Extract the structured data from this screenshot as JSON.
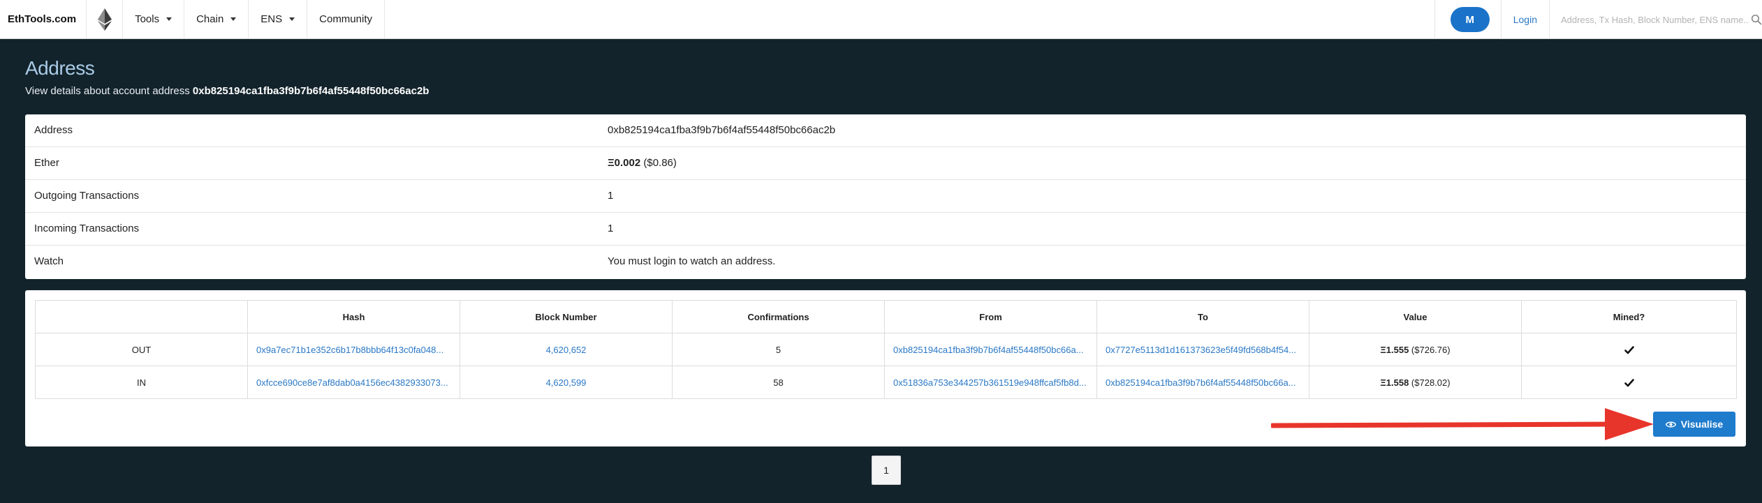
{
  "navbar": {
    "brand": "EthTools.com",
    "logo_icon": "ethereum-diamond-icon",
    "menu": [
      {
        "label": "Tools",
        "dropdown": true
      },
      {
        "label": "Chain",
        "dropdown": true
      },
      {
        "label": "ENS",
        "dropdown": true
      },
      {
        "label": "Community",
        "dropdown": false
      }
    ],
    "avatar_label": "M",
    "login_label": "Login",
    "search_placeholder": "Address, Tx Hash, Block Number, ENS name...",
    "search_icon": "search-icon"
  },
  "header": {
    "title": "Address",
    "subtitle_prefix": "View details about account address ",
    "subtitle_address": "0xb825194ca1fba3f9b7b6f4af55448f50bc66ac2b"
  },
  "details": [
    {
      "key": "Address",
      "value": "0xb825194ca1fba3f9b7b6f4af55448f50bc66ac2b"
    },
    {
      "key": "Ether",
      "value_bold": "Ξ0.002",
      "value_extra": " ($0.86)"
    },
    {
      "key": "Outgoing Transactions",
      "value": "1"
    },
    {
      "key": "Incoming Transactions",
      "value": "1"
    },
    {
      "key": "Watch",
      "value": "You must login to watch an address."
    }
  ],
  "transactions": {
    "columns": [
      "",
      "Hash",
      "Block Number",
      "Confirmations",
      "From",
      "To",
      "Value",
      "Mined?"
    ],
    "rows": [
      {
        "direction": "OUT",
        "hash": "0x9a7ec71b1e352c6b17b8bbb64f13c0fa048...",
        "block": "4,620,652",
        "confirmations": "5",
        "from": "0xb825194ca1fba3f9b7b6f4af55448f50bc66a...",
        "to": "0x7727e5113d1d161373623e5f49fd568b4f54...",
        "value_bold": "Ξ1.555",
        "value_extra": " ($726.76)",
        "mined_icon": "checkmark-icon"
      },
      {
        "direction": "IN",
        "hash": "0xfcce690ce8e7af8dab0a4156ec4382933073...",
        "block": "4,620,599",
        "confirmations": "58",
        "from": "0x51836a753e344257b361519e948ffcaf5fb8d...",
        "to": "0xb825194ca1fba3f9b7b6f4af55448f50bc66a...",
        "value_bold": "Ξ1.558",
        "value_extra": " ($728.02)",
        "mined_icon": "checkmark-icon"
      }
    ],
    "visualise_label": "Visualise",
    "visualise_icon": "eye-icon"
  },
  "annotation": {
    "arrow_color": "#e8352b"
  },
  "pagination": {
    "current_page": "1"
  },
  "colors": {
    "background": "#13232b",
    "accent": "#1f7ccd",
    "link": "#2a78c5",
    "title": "#a9cbe6"
  }
}
